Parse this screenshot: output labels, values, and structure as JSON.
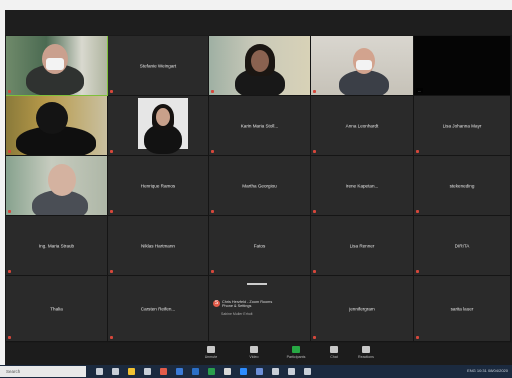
{
  "window": {
    "app": "Zoom Meeting"
  },
  "participants": [
    {
      "name": "",
      "video": "man-mask-green",
      "active": true
    },
    {
      "name": "Stefanie Weingart",
      "video": null
    },
    {
      "name": "",
      "video": "woman-dark-hair"
    },
    {
      "name": "",
      "video": "man-mask-office"
    },
    {
      "name": "",
      "video": "black",
      "label": "..."
    },
    {
      "name": "",
      "video": "dark-silhouette"
    },
    {
      "name": "",
      "video": "woman-phone"
    },
    {
      "name": "Karin Maria Stoll...",
      "video": null
    },
    {
      "name": "Anna Leonhardt",
      "video": null
    },
    {
      "name": "Lisa Johanna Mayr",
      "video": null
    },
    {
      "name": "",
      "video": "older-man"
    },
    {
      "name": "Henrique Ramos",
      "video": null
    },
    {
      "name": "Martha Georgiou",
      "video": null
    },
    {
      "name": "Irene Kapetan...",
      "video": null
    },
    {
      "name": "stekeneding",
      "video": null
    },
    {
      "name": "Ing. Maria Straub",
      "video": null
    },
    {
      "name": "Niklas Hartmann",
      "video": null
    },
    {
      "name": "Fatos",
      "video": null
    },
    {
      "name": "Lisa Renner",
      "video": null
    },
    {
      "name": "DIRITA",
      "video": null
    },
    {
      "name": "Thalia",
      "video": null
    },
    {
      "name": "Carsten Reifen...",
      "video": null
    },
    {
      "name": "",
      "video": "presenter"
    },
    {
      "name": "jennifergram",
      "video": null
    },
    {
      "name": "sarita lauer",
      "video": null
    }
  ],
  "presenter_tile": {
    "icon_letter": "S",
    "lines": [
      "Chris Herzfeld - Zoom Rooms",
      "Phone & Settings"
    ],
    "sub": "Sabine Muller Erholt"
  },
  "controls": [
    {
      "label": "Unmute",
      "icon": "microphone-icon"
    },
    {
      "label": "Video",
      "icon": "video-camera-icon"
    },
    {
      "label": "Participants",
      "icon": "participants-icon"
    },
    {
      "label": "Chat",
      "icon": "chat-icon"
    },
    {
      "label": "Reactions",
      "icon": "reactions-icon"
    }
  ],
  "taskbar": {
    "search_placeholder": "Search",
    "tray_text": "ENG  10:31  08/04/2020"
  },
  "colors": {
    "active_speaker": "#7fbf3a",
    "muted": "#d6473b",
    "participants_button": "#27a844"
  }
}
